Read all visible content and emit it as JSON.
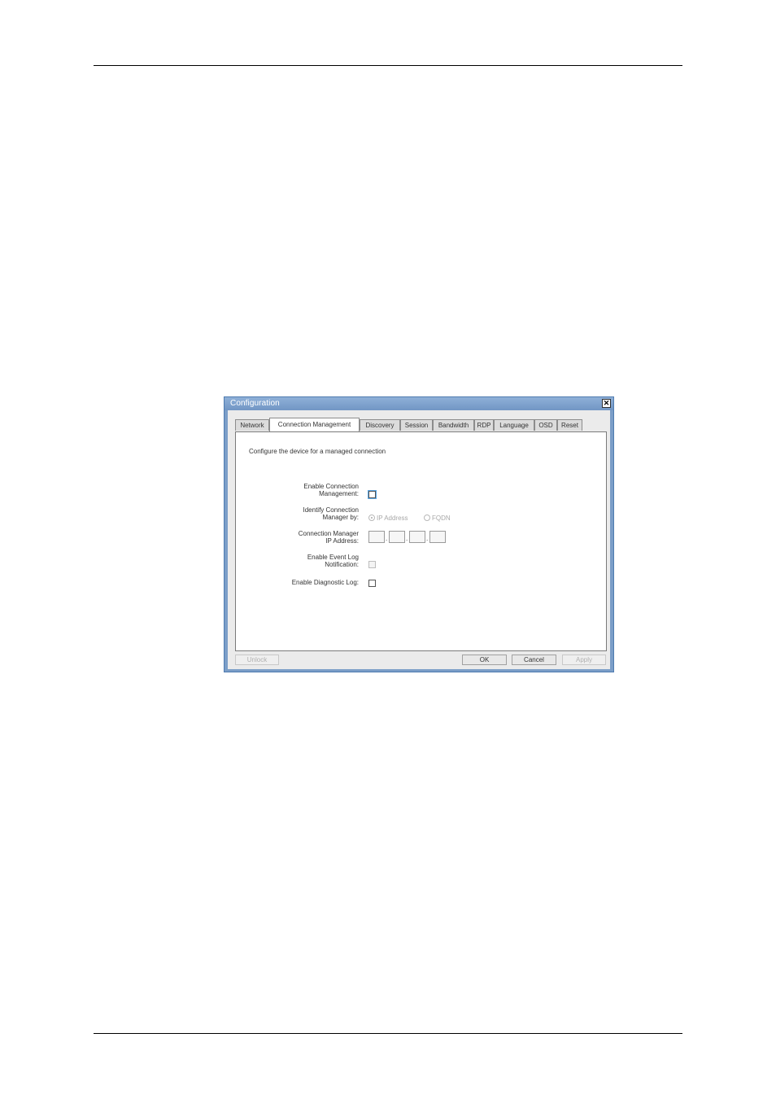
{
  "window": {
    "title": "Configuration",
    "close_glyph": "✕"
  },
  "tabs": [
    {
      "label": "Network",
      "active": false
    },
    {
      "label": "Connection Management",
      "active": true
    },
    {
      "label": "Discovery",
      "active": false
    },
    {
      "label": "Session",
      "active": false
    },
    {
      "label": "Bandwidth",
      "active": false
    },
    {
      "label": "RDP",
      "active": false
    },
    {
      "label": "Language",
      "active": false
    },
    {
      "label": "OSD",
      "active": false
    },
    {
      "label": "Reset",
      "active": false
    }
  ],
  "panel": {
    "intro": "Configure the device for a managed connection",
    "enable_cm": {
      "label_line1": "Enable Connection",
      "label_line2": "Management:",
      "checked": false
    },
    "identify": {
      "label_line1": "Identify Connection",
      "label_line2": "Manager by:",
      "option_ip": "IP Address",
      "option_fqdn": "FQDN",
      "selected": "IP Address"
    },
    "cm_ip": {
      "label_line1": "Connection Manager",
      "label_line2": "IP Address:",
      "octets": [
        "",
        "",
        "",
        ""
      ],
      "separator": "."
    },
    "event_log": {
      "label_line1": "Enable Event Log",
      "label_line2": "Notification:",
      "checked": false
    },
    "diag_log": {
      "label": "Enable Diagnostic Log:",
      "checked": false
    }
  },
  "footer": {
    "unlock": "Unlock",
    "ok": "OK",
    "cancel": "Cancel",
    "apply": "Apply"
  },
  "icons": {
    "close": "close-icon",
    "checkbox": "checkbox-icon",
    "radio": "radio-icon"
  }
}
